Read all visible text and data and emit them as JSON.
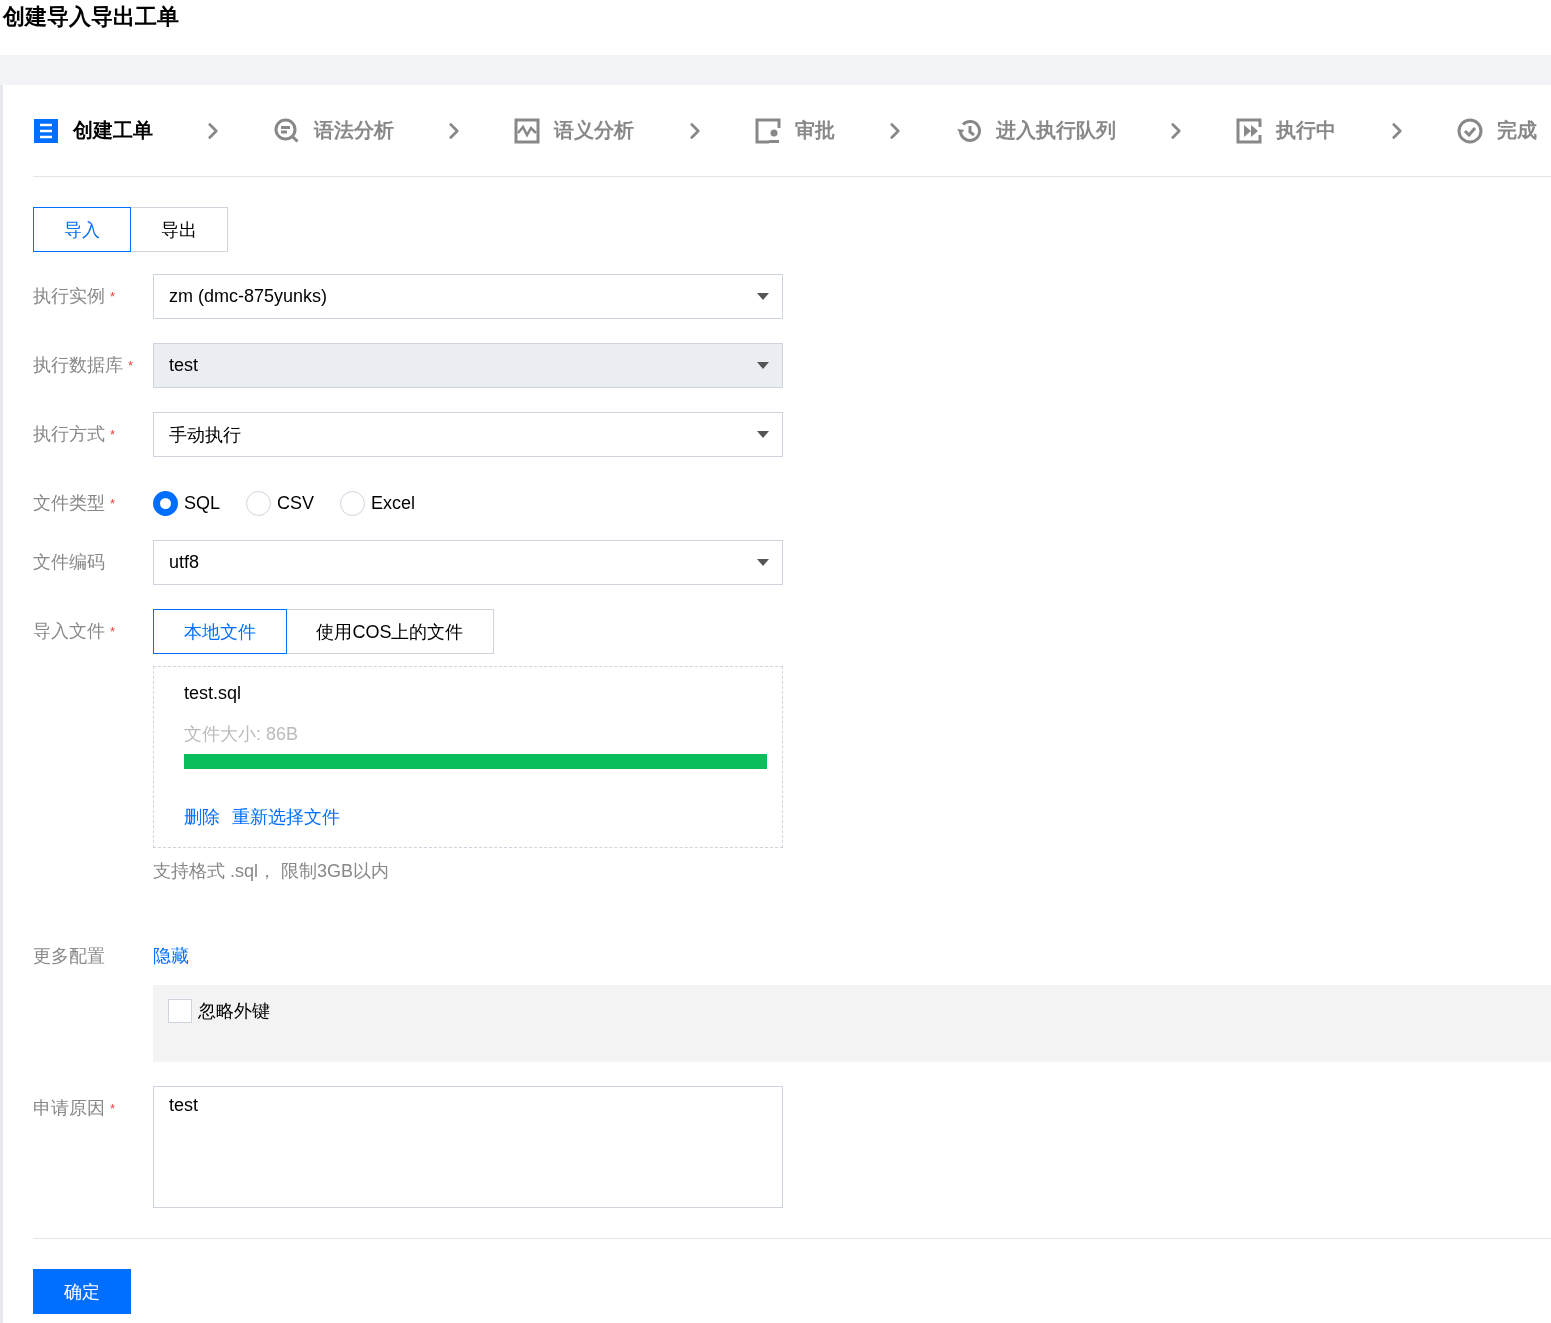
{
  "page_title": "创建导入导出工单",
  "steps": [
    {
      "label": "创建工单",
      "selected": true
    },
    {
      "label": "语法分析",
      "selected": false
    },
    {
      "label": "语义分析",
      "selected": false
    },
    {
      "label": "审批",
      "selected": false
    },
    {
      "label": "进入执行队列",
      "selected": false
    },
    {
      "label": "执行中",
      "selected": false
    },
    {
      "label": "完成",
      "selected": false
    }
  ],
  "mode_tabs": [
    {
      "label": "导入",
      "selected": true
    },
    {
      "label": "导出",
      "selected": false
    }
  ],
  "fields": [
    {
      "kind": "select",
      "label": "执行实例",
      "required_mark": "*",
      "value": "zm (dmc-875yunks)",
      "disabled": false
    },
    {
      "kind": "select",
      "label": "执行数据库",
      "required_mark": "*",
      "value": "test",
      "disabled": true
    },
    {
      "kind": "select",
      "label": "执行方式",
      "required_mark": "*",
      "value": "手动执行",
      "disabled": false
    },
    {
      "kind": "radio",
      "label": "文件类型",
      "required_mark": "*",
      "options": [
        {
          "label": "SQL",
          "selected": true
        },
        {
          "label": "CSV",
          "selected": false
        },
        {
          "label": "Excel",
          "selected": false
        }
      ]
    },
    {
      "kind": "select",
      "label": "文件编码",
      "value": "utf8",
      "disabled": false
    },
    {
      "kind": "upload",
      "label": "导入文件",
      "required_mark": "*",
      "sources": [
        {
          "label": "本地文件",
          "selected": true
        },
        {
          "label": "使用COS上的文件",
          "selected": false
        }
      ],
      "file": {
        "name": "test.sql",
        "size": "文件大小: 86B",
        "level": 1,
        "actions": [
          "删除",
          "重新选择文件"
        ]
      },
      "hint": "支持格式 .sql， 限制3GB以内"
    },
    {
      "kind": "more",
      "label": "更多配置",
      "toggle": "隐藏",
      "options": [
        {
          "label": "忽略外键",
          "checked": false
        }
      ]
    },
    {
      "kind": "textarea",
      "label": "申请原因",
      "required_mark": "*",
      "value": "test"
    }
  ],
  "submit": "确定"
}
